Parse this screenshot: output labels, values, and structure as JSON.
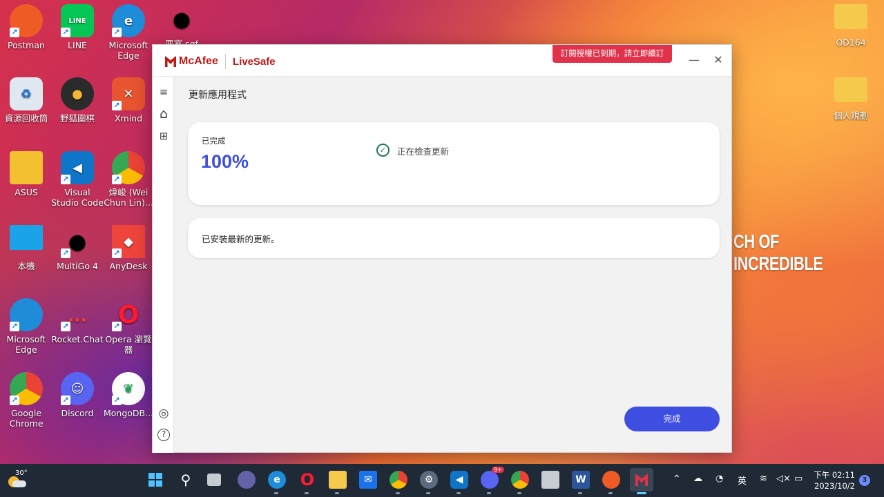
{
  "desktop": {
    "wallpaper_text": "CH OF INCREDIBLE",
    "icons": [
      {
        "label": "Postman",
        "glyph": "",
        "color": "#ef5b25"
      },
      {
        "label": "LINE",
        "glyph": "LINE",
        "color": "#06c755"
      },
      {
        "label": "Microsoft Edge",
        "glyph": "e",
        "color": "#1e8cd8"
      },
      {
        "label": "悪室.sgf",
        "glyph": "●",
        "color": "#ffffff"
      },
      {
        "label": "資源回收筒",
        "glyph": "♻",
        "color": "#dfe8f0"
      },
      {
        "label": "野狐圍棋",
        "glyph": "●",
        "color": "#2b2b2b"
      },
      {
        "label": "Xmind",
        "glyph": "✕",
        "color": "#e8542f"
      },
      {
        "label": "ASUS",
        "glyph": "👤",
        "color": "#f3c02f"
      },
      {
        "label": "Visual Studio Code",
        "glyph": "◀",
        "color": "#0e75c9"
      },
      {
        "label": "煒峻 (Wei Chun Lin)...",
        "glyph": "",
        "color": "#dd4b39"
      },
      {
        "label": "本機",
        "glyph": "",
        "color": "#1aa3e8"
      },
      {
        "label": "MultiGo 4",
        "glyph": "●",
        "color": "#ffffff"
      },
      {
        "label": "AnyDesk",
        "glyph": "◆",
        "color": "#ef443b"
      },
      {
        "label": "Microsoft Edge",
        "glyph": "e",
        "color": "#1e8cd8"
      },
      {
        "label": "Rocket.Chat",
        "glyph": "…",
        "color": "#e13d45"
      },
      {
        "label": "Opera 瀏覽器",
        "glyph": "O",
        "color": "#ff1b2d"
      },
      {
        "label": "Google Chrome",
        "glyph": "",
        "color": "#4285f4"
      },
      {
        "label": "Discord",
        "glyph": "☺",
        "color": "#5865f2"
      },
      {
        "label": "MongoDB...",
        "glyph": "❦",
        "color": "#ffffff"
      },
      {
        "label": "OD164",
        "glyph": "",
        "color": "#f5c94c"
      },
      {
        "label": "個人規劃",
        "glyph": "",
        "color": "#f5c94c"
      }
    ]
  },
  "window": {
    "brand": "McAfee",
    "product": "LiveSafe",
    "banner": "訂閱授權已到期，請立即續訂",
    "minimize": "—",
    "close": "✕"
  },
  "sidebar": {
    "menu_icon": "≡",
    "home_icon": "⌂",
    "apps_icon": "⊞",
    "account_icon": "◎",
    "help_icon": "?"
  },
  "main": {
    "title": "更新應用程式",
    "status_label": "已完成",
    "status_value": "100%",
    "check_text": "正在檢查更新",
    "installed_text": "已安裝最新的更新。",
    "done_button": "完成"
  },
  "taskbar": {
    "temperature": "30°",
    "ime": "英",
    "time": "下午 02:11",
    "date": "2023/10/2",
    "notification_count": "3",
    "discord_badge": "9+"
  }
}
